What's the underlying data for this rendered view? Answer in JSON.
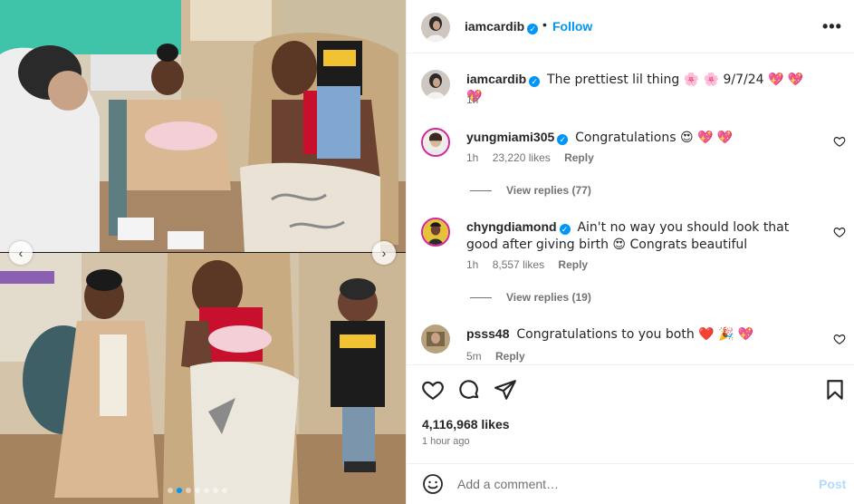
{
  "post": {
    "username": "iamcardib",
    "follow_label": "Follow",
    "separator": "•",
    "more_label": "•••"
  },
  "caption": {
    "username": "iamcardib",
    "text": "The prettiest lil thing 🌸 🌸 9/7/24 💖 💖 💖",
    "time": "1h"
  },
  "comments": [
    {
      "username": "yungmiami305",
      "text": "Congratulations 😍 💖 💖",
      "time": "1h",
      "likes": "23,220 likes",
      "reply_label": "Reply",
      "view_replies": "View replies (77)"
    },
    {
      "username": "chyngdiamond",
      "text": "Ain't no way you should look that good after giving birth 😍 Congrats beautiful",
      "time": "1h",
      "likes": "8,557 likes",
      "reply_label": "Reply",
      "view_replies": "View replies (19)"
    },
    {
      "username": "psss48",
      "text": "Congratulations to you both ❤️ 🎉 💖",
      "time": "5m",
      "reply_label": "Reply"
    }
  ],
  "stats": {
    "likes": "4,116,968 likes",
    "time": "1 hour ago"
  },
  "composer": {
    "placeholder": "Add a comment…",
    "post_label": "Post"
  },
  "carousel": {
    "prev": "‹",
    "next": "›",
    "dot_count": 7,
    "active_dot": 1
  },
  "colors": {
    "accent": "#0095f6",
    "muted": "#737373",
    "text": "#262626"
  }
}
